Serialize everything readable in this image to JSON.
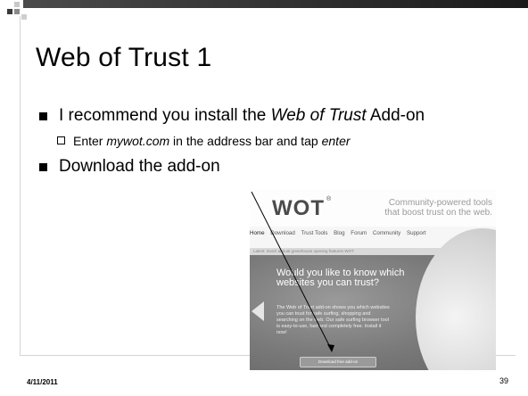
{
  "slide": {
    "title": "Web of Trust 1",
    "bullets": [
      {
        "text_before": "I recommend you install the ",
        "text_emphasis": "Web of Trust",
        "text_after": " Add-on",
        "sub": {
          "before": "Enter ",
          "emphasis": "mywot.com",
          "middle": " in the address bar and tap ",
          "emphasis2": "enter"
        }
      },
      {
        "text": "Download the add-on"
      }
    ],
    "footer": {
      "date": "4/11/2011",
      "page_number": "39"
    }
  },
  "screenshot": {
    "logo": "WOT",
    "logo_mark": "®",
    "tagline": "Community-powered tools that boost trust on the web.",
    "nav": [
      "Home",
      "Download",
      "Trust Tools",
      "Blog",
      "Forum",
      "Community",
      "Support"
    ],
    "strip_text": "Latest: Dutch annual greenhouse opening features WOT",
    "question": "Would you like to know which websites you can trust?",
    "description": "The Web of Trust add-on shows you which websites you can trust for safe surfing, shopping and searching on the web. Our safe surfing browser tool is easy-to-use, fast and completely free. Install it now!",
    "download_button": "Download free add-on"
  }
}
